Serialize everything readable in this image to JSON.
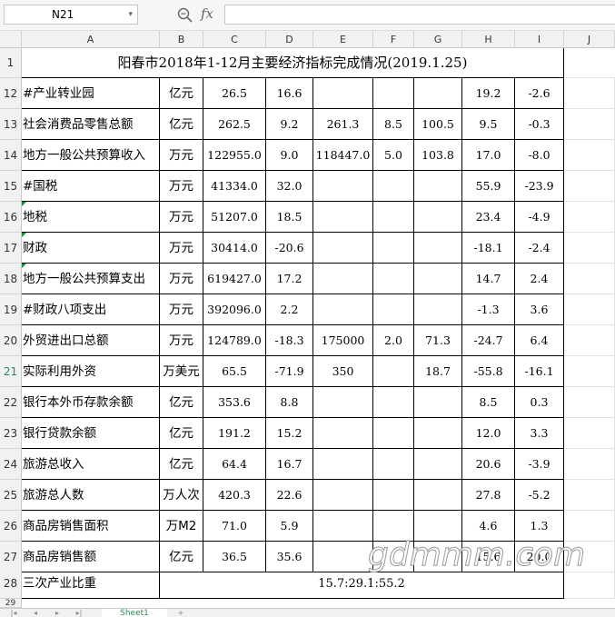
{
  "toolbar": {
    "name_box": "N21",
    "fx_label": "fx",
    "formula": ""
  },
  "columns": [
    "A",
    "B",
    "C",
    "D",
    "E",
    "F",
    "G",
    "H",
    "I",
    "J"
  ],
  "title": {
    "row": "1",
    "text": "阳春市2018年1-12月主要经济指标完成情况(2019.1.25)"
  },
  "rows": [
    {
      "num": "12",
      "cells": [
        "#产业转业园",
        "亿元",
        "26.5",
        "16.6",
        "",
        "",
        "",
        "19.2",
        "-2.6"
      ]
    },
    {
      "num": "13",
      "cells": [
        "社会消费品零售总额",
        "亿元",
        "262.5",
        "9.2",
        "261.3",
        "8.5",
        "100.5",
        "9.5",
        "-0.3"
      ]
    },
    {
      "num": "14",
      "cells": [
        "地方一般公共预算收入",
        "万元",
        "122955.0",
        "9.0",
        "118447.0",
        "5.0",
        "103.8",
        "17.0",
        "-8.0"
      ]
    },
    {
      "num": "15",
      "cells": [
        "#国税",
        "万元",
        "41334.0",
        "32.0",
        "",
        "",
        "",
        "55.9",
        "-23.9"
      ]
    },
    {
      "num": "16",
      "cells": [
        " 地税",
        "万元",
        "51207.0",
        "18.5",
        "",
        "",
        "",
        "23.4",
        "-4.9"
      ]
    },
    {
      "num": "17",
      "cells": [
        " 财政",
        "万元",
        "30414.0",
        "-20.6",
        "",
        "",
        "",
        "-18.1",
        "-2.4"
      ]
    },
    {
      "num": "18",
      "cells": [
        " 地方一般公共预算支出",
        "万元",
        "619427.0",
        "17.2",
        "",
        "",
        "",
        "14.7",
        "2.4"
      ]
    },
    {
      "num": "19",
      "cells": [
        "#财政八项支出",
        "万元",
        "392096.0",
        "2.2",
        "",
        "",
        "",
        "-1.3",
        "3.6"
      ]
    },
    {
      "num": "20",
      "cells": [
        "外贸进出口总额",
        "万元",
        "124789.0",
        "-18.3",
        "175000",
        "2.0",
        "71.3",
        "-24.7",
        "6.4"
      ]
    },
    {
      "num": "21",
      "cells": [
        "实际利用外资",
        "万美元",
        "65.5",
        "-71.9",
        "350",
        "",
        "18.7",
        "-55.8",
        "-16.1"
      ]
    },
    {
      "num": "22",
      "cells": [
        "银行本外币存款余额",
        "亿元",
        "353.6",
        "8.8",
        "",
        "",
        "",
        "8.5",
        "0.3"
      ]
    },
    {
      "num": "23",
      "cells": [
        "银行贷款余额",
        "亿元",
        "191.2",
        "15.2",
        "",
        "",
        "",
        "12.0",
        "3.3"
      ]
    },
    {
      "num": "24",
      "cells": [
        "旅游总收入",
        "亿元",
        "64.4",
        "16.7",
        "",
        "",
        "",
        "20.6",
        "-3.9"
      ]
    },
    {
      "num": "25",
      "cells": [
        "旅游总人数",
        "万人次",
        "420.3",
        "22.6",
        "",
        "",
        "",
        "27.8",
        "-5.2"
      ]
    },
    {
      "num": "26",
      "cells": [
        "商品房销售面积",
        "万M2",
        "71.0",
        "5.9",
        "",
        "",
        "",
        "4.6",
        "1.3"
      ]
    },
    {
      "num": "27",
      "cells": [
        "商品房销售额",
        "亿元",
        "36.5",
        "35.6",
        "",
        "",
        "",
        "15.6",
        "20.0"
      ]
    }
  ],
  "row28": {
    "num": "28",
    "label": "三次产业比重",
    "value": "15.7:29.1:55.2"
  },
  "row29": {
    "num": "29"
  },
  "sheet": {
    "tab_label": "Sheet1",
    "add": "+"
  },
  "watermark": "gdmmm.com",
  "selected_row": "21"
}
